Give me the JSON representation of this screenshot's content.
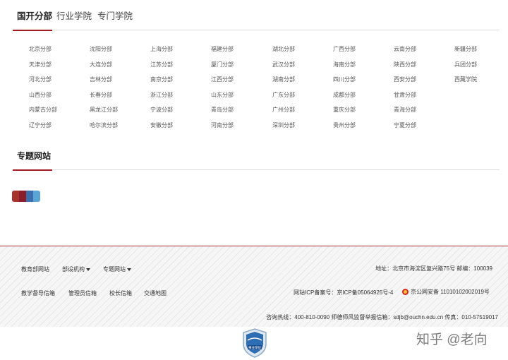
{
  "tabs": [
    {
      "label": "国开分部",
      "active": true
    },
    {
      "label": "行业学院",
      "active": false
    },
    {
      "label": "专门学院",
      "active": false
    }
  ],
  "branches": [
    [
      "北京分部",
      "天津分部",
      "河北分部",
      "山西分部",
      "内蒙古分部",
      "辽宁分部"
    ],
    [
      "沈阳分部",
      "大连分部",
      "吉林分部",
      "长春分部",
      "黑龙江分部",
      "哈尔滨分部"
    ],
    [
      "上海分部",
      "江苏分部",
      "南京分部",
      "浙江分部",
      "宁波分部",
      "安徽分部"
    ],
    [
      "福建分部",
      "厦门分部",
      "江西分部",
      "山东分部",
      "青岛分部",
      "河南分部"
    ],
    [
      "湖北分部",
      "武汉分部",
      "湖南分部",
      "广东分部",
      "广州分部",
      "深圳分部"
    ],
    [
      "广西分部",
      "海南分部",
      "四川分部",
      "成都分部",
      "重庆分部",
      "贵州分部"
    ],
    [
      "云南分部",
      "陕西分部",
      "西安分部",
      "甘肃分部",
      "青海分部",
      "宁夏分部"
    ],
    [
      "新疆分部",
      "兵团分部",
      "西藏学院"
    ]
  ],
  "special_section": {
    "title": "专题网站"
  },
  "special_site_colors": [
    "#a8332d",
    "#8a1f2b",
    "#3b6fb0",
    "#5aa4d6"
  ],
  "footer": {
    "row1_links": [
      {
        "label": "教育部网站",
        "dropdown": false
      },
      {
        "label": "部设机构",
        "dropdown": true
      },
      {
        "label": "专题网站",
        "dropdown": true
      }
    ],
    "address": "地址：北京市海淀区复兴路75号  邮编：100039",
    "row2_links": [
      {
        "label": "教学督导信箱"
      },
      {
        "label": "管理员信箱"
      },
      {
        "label": "校长信箱"
      },
      {
        "label": "交通地图"
      }
    ],
    "icp": "网站ICP备案号：京ICP备05064925号-4",
    "police": "京公网安备 11010102002019号",
    "contact": "咨询热线：400-810-0090   师德师风监督举报信箱：sdjb@ouchn.edu.cn   传真：010-57519017"
  },
  "badge": {
    "label": "事业单位",
    "icon": "government-badge-icon"
  },
  "watermark": "知乎 @老向",
  "colors": {
    "accent": "#a11a1f",
    "footer_border": "#b02a30"
  }
}
